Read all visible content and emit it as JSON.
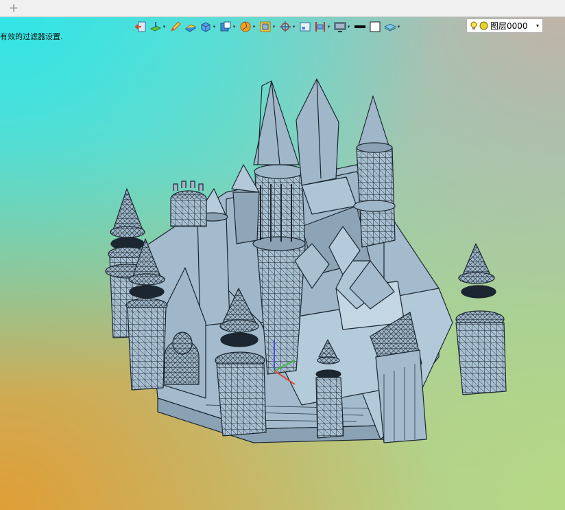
{
  "tabbar": {
    "add_label": "+"
  },
  "hint_text": "有效的过滤器设置.",
  "toolbar": {
    "items": [
      {
        "name": "exit-sketch-icon"
      },
      {
        "name": "plane-icon",
        "dropdown": true
      },
      {
        "name": "pen-icon"
      },
      {
        "name": "sheet-icon"
      },
      {
        "name": "box-view-icon",
        "dropdown": true
      },
      {
        "name": "cube-display-icon",
        "dropdown": true
      },
      {
        "name": "render-icon",
        "dropdown": true
      },
      {
        "name": "frame-icon",
        "dropdown": true
      },
      {
        "name": "crosshair-icon",
        "dropdown": true
      },
      {
        "name": "screen-icon"
      },
      {
        "name": "align-icon",
        "dropdown": true
      },
      {
        "name": "monitor-icon",
        "dropdown": true
      },
      {
        "name": "line-color-icon"
      },
      {
        "name": "fill-color-icon"
      },
      {
        "name": "layer-stack-icon",
        "dropdown": true
      }
    ],
    "layer": {
      "value": "图层0000",
      "arrow": "▾"
    }
  },
  "colors": {
    "model_fill": "#9fb7c9",
    "model_edge": "#1b2630",
    "tabbar_bg": "#f0f0f0"
  }
}
